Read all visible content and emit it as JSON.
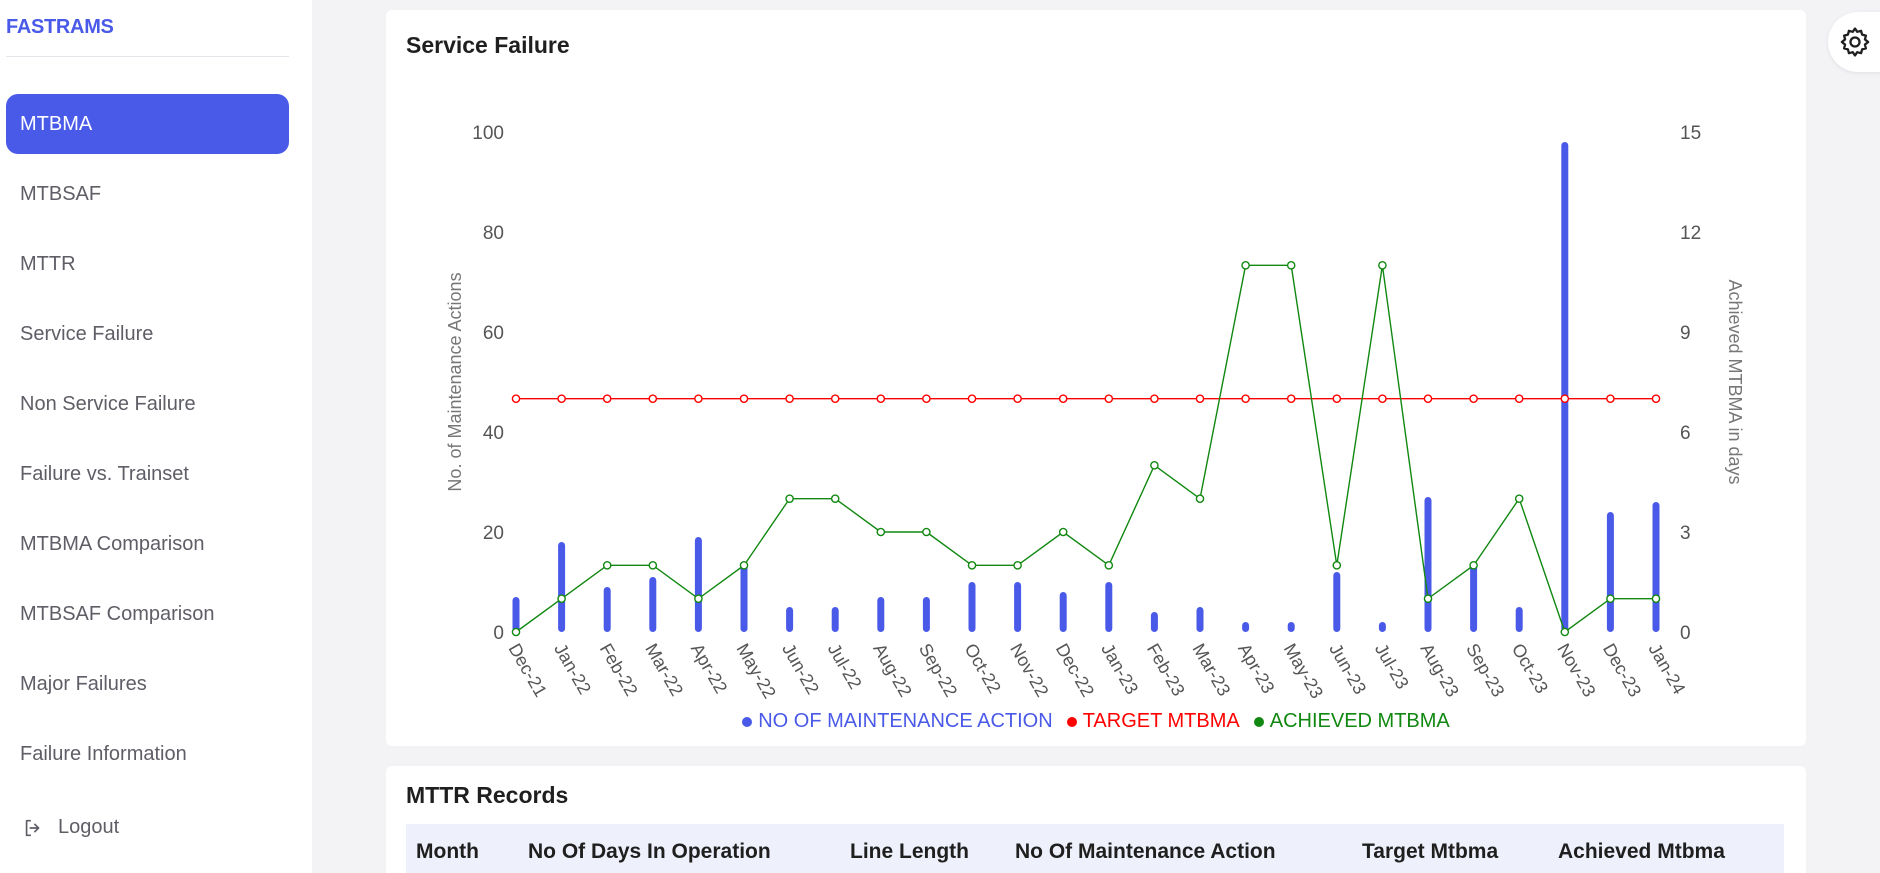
{
  "brand": "FASTRAMS",
  "sidebar": {
    "items": [
      {
        "label": "MTBMA",
        "active": true
      },
      {
        "label": "MTBSAF",
        "active": false
      },
      {
        "label": "MTTR",
        "active": false
      },
      {
        "label": "Service Failure",
        "active": false
      },
      {
        "label": "Non Service Failure",
        "active": false
      },
      {
        "label": "Failure vs. Trainset",
        "active": false
      },
      {
        "label": "MTBMA Comparison",
        "active": false
      },
      {
        "label": "MTBSAF Comparison",
        "active": false
      },
      {
        "label": "Major Failures",
        "active": false
      },
      {
        "label": "Failure Information",
        "active": false
      }
    ],
    "logout_label": "Logout"
  },
  "chart_card": {
    "title": "Service Failure"
  },
  "chart_data": {
    "type": "bar",
    "categories": [
      "Dec-21",
      "Jan-22",
      "Feb-22",
      "Mar-22",
      "Apr-22",
      "May-22",
      "Jun-22",
      "Jul-22",
      "Aug-22",
      "Sep-22",
      "Oct-22",
      "Nov-22",
      "Dec-22",
      "Jan-23",
      "Feb-23",
      "Mar-23",
      "Apr-23",
      "May-23",
      "Jun-23",
      "Jul-23",
      "Aug-23",
      "Sep-23",
      "Oct-23",
      "Nov-23",
      "Dec-23",
      "Jan-24"
    ],
    "series": [
      {
        "name": "NO OF MAINTENANCE ACTION",
        "type": "bar",
        "axis": "left",
        "color": "#4a5ae8",
        "values": [
          7,
          18,
          9,
          11,
          19,
          14,
          5,
          5,
          7,
          7,
          10,
          10,
          8,
          10,
          4,
          5,
          2,
          2,
          12,
          2,
          27,
          14,
          5,
          98,
          24,
          26
        ]
      },
      {
        "name": "TARGET MTBMA",
        "type": "line",
        "axis": "right",
        "color": "#ff0000",
        "values": [
          7,
          7,
          7,
          7,
          7,
          7,
          7,
          7,
          7,
          7,
          7,
          7,
          7,
          7,
          7,
          7,
          7,
          7,
          7,
          7,
          7,
          7,
          7,
          7,
          7,
          7
        ]
      },
      {
        "name": "ACHIEVED MTBMA",
        "type": "line",
        "axis": "right",
        "color": "#118811",
        "values": [
          0,
          1,
          2,
          2,
          1,
          2,
          4,
          4,
          3,
          3,
          2,
          2,
          3,
          2,
          5,
          4,
          11,
          11,
          2,
          11,
          1,
          2,
          4,
          0,
          1,
          1
        ]
      }
    ],
    "ylabel": "No. of Maintenance Actions",
    "ylim": [
      0,
      100
    ],
    "yticks": [
      0,
      20,
      40,
      60,
      80,
      100
    ],
    "y2label": "Achieved MTBMA in days",
    "y2lim": [
      0,
      15
    ],
    "y2ticks": [
      0,
      3,
      6,
      9,
      12,
      15
    ],
    "legend_position": "bottom",
    "grid": false
  },
  "table_card": {
    "title": "MTTR Records",
    "columns": [
      "Month",
      "No Of Days In Operation",
      "Line Length",
      "No Of Maintenance Action",
      "Target Mtbma",
      "Achieved Mtbma"
    ]
  },
  "colors": {
    "accent": "#4a5ae8",
    "target": "#ff0000",
    "achieved": "#118811"
  },
  "icons": {
    "logout": "logout-icon",
    "settings": "gear-icon"
  }
}
